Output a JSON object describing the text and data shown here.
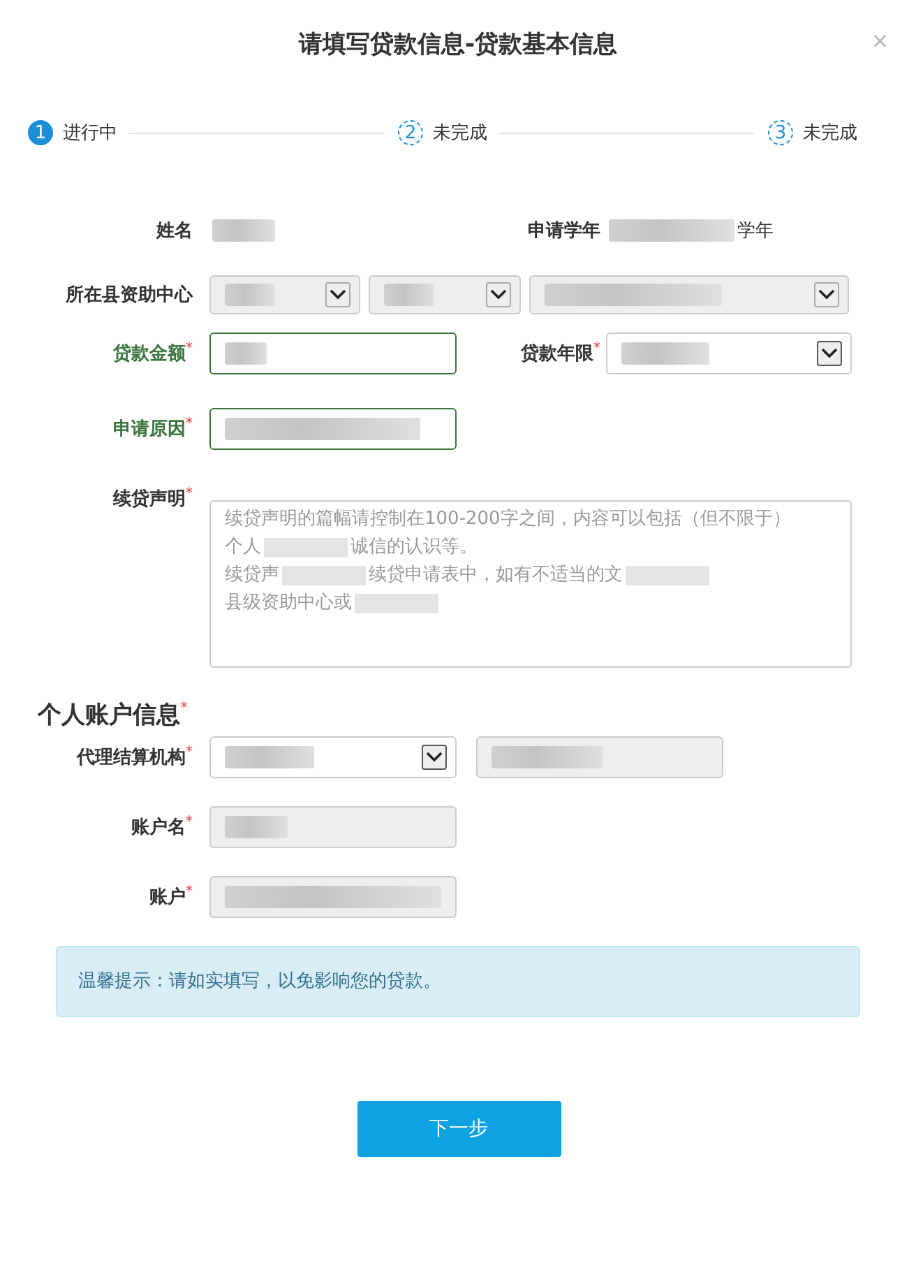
{
  "dialog": {
    "title": "请填写贷款信息-贷款基本信息",
    "close": "×"
  },
  "steps": [
    {
      "number": "1",
      "label": "进行中",
      "selected": true
    },
    {
      "number": "2",
      "label": "未完成",
      "selected": false
    },
    {
      "number": "3",
      "label": "未完成",
      "selected": false
    }
  ],
  "form_rows": [
    {
      "fields": [
        {
          "label": "姓名",
          "valid": false,
          "controls": [
            {
              "kind": "static"
            }
          ]
        },
        {
          "label": "申请学年",
          "valid": false,
          "controls": [
            {
              "kind": "static",
              "suffix": "学年"
            }
          ]
        }
      ]
    },
    {
      "fields": [
        {
          "label": "所在县资助中心",
          "valid": false,
          "controls": [
            {
              "kind": "select",
              "disabled": true
            },
            {
              "kind": "select",
              "disabled": true
            },
            {
              "kind": "select",
              "disabled": true
            }
          ]
        }
      ]
    },
    {
      "fields": [
        {
          "label": "贷款金额",
          "required_mark": "*",
          "valid": true,
          "controls": [
            {
              "kind": "input",
              "disabled": false
            }
          ]
        },
        {
          "label": "贷款年限",
          "required_mark": "*",
          "valid": false,
          "controls": [
            {
              "kind": "select",
              "disabled": false
            }
          ]
        }
      ]
    },
    {
      "fields": [
        {
          "label": "申请原因",
          "required_mark": "*",
          "valid": true,
          "controls": [
            {
              "kind": "input",
              "disabled": false
            }
          ]
        }
      ]
    },
    {
      "fields": [
        {
          "label": "续贷声明",
          "required_mark": "*",
          "valid": false,
          "controls": [
            {
              "kind": "textarea",
              "placeholder_lines": [
                [
                  {
                    "kind": "text",
                    "text": "续贷声明的篇幅请控制在100-200字之间，内容可以包括（但不限于）"
                  }
                ],
                [
                  {
                    "kind": "text",
                    "text": "个人"
                  },
                  {
                    "kind": "blur"
                  },
                  {
                    "kind": "text",
                    "text": "诚信的认识等。"
                  }
                ],
                [
                  {
                    "kind": "text",
                    "text": "续贷声"
                  },
                  {
                    "kind": "blur"
                  },
                  {
                    "kind": "text",
                    "text": "续贷申请表中，如有不适当的文"
                  },
                  {
                    "kind": "blur"
                  }
                ],
                [
                  {
                    "kind": "text",
                    "text": "县级资助中心或"
                  },
                  {
                    "kind": "blur"
                  }
                ]
              ]
            }
          ]
        }
      ]
    }
  ],
  "section": {
    "title": "个人账户信息",
    "required_mark": "*"
  },
  "account_rows": [
    {
      "fields": [
        {
          "label": "代理结算机构",
          "required_mark": "*",
          "valid": false,
          "controls": [
            {
              "kind": "select",
              "disabled": false
            },
            {
              "kind": "readonly"
            }
          ]
        }
      ]
    },
    {
      "fields": [
        {
          "label": "账户名",
          "required_mark": "*",
          "valid": false,
          "controls": [
            {
              "kind": "readonly"
            }
          ]
        }
      ]
    },
    {
      "fields": [
        {
          "label": "账户",
          "required_mark": "*",
          "valid": false,
          "controls": [
            {
              "kind": "readonly"
            }
          ]
        }
      ]
    }
  ],
  "notice": "温馨提示：请如实填写，以免影响您的贷款。",
  "next_button": "下一步"
}
